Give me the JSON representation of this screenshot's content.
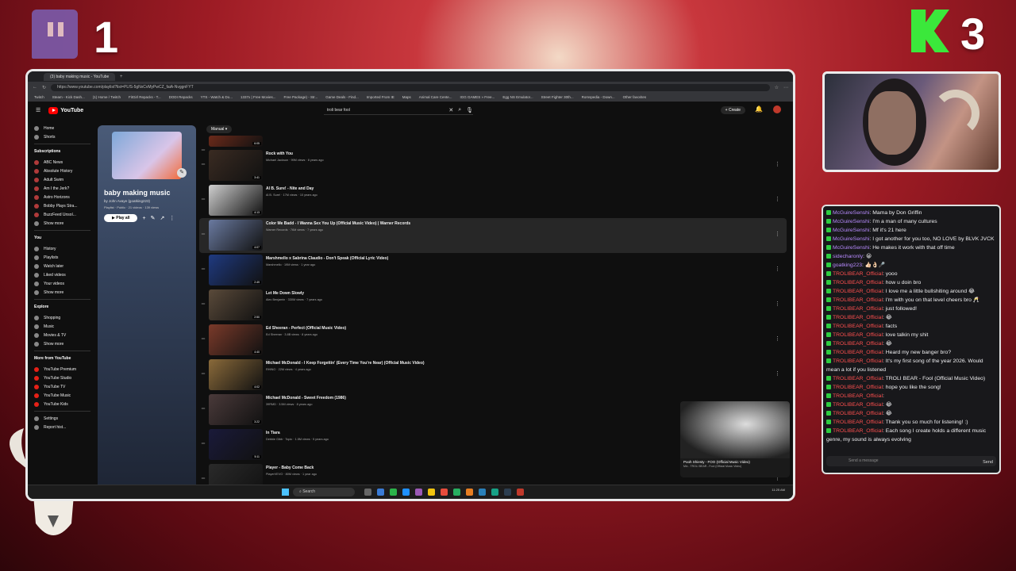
{
  "overlay": {
    "twitch_count": "1",
    "kick_count": "3"
  },
  "browser": {
    "tabs": [
      "(3) baby making music - YouTube"
    ],
    "url": "https://www.youtube.com/playlist?list=PLfS-5gNxCvMyPwCZ_faiA-NvggnFYT",
    "bookmarks": [
      "Twitch",
      "Steam - Kick Dash...",
      "(1) Home / Twitch",
      "FitGirl Repacks - T...",
      "DODI Repacks",
      "YTS - Watch & Do...",
      "1337x | Free Movies...",
      "Free Package) - Str...",
      "Game Deals - Find...",
      "Imported From IE",
      "Maps",
      "Animal Care Cente...",
      "IGG GAMES » Free...",
      "Egg NS Emulator...",
      "Street Fighter 30th...",
      "Romspedia - Down...",
      "Other favorites"
    ]
  },
  "youtube": {
    "logo_text": "YouTube",
    "search_value": "troli bear fool",
    "create_label": "Create",
    "sidebar": {
      "top": [
        "Home",
        "Shorts"
      ],
      "subscriptions_header": "Subscriptions",
      "subscriptions": [
        "ABC News",
        "Absolute History",
        "Adult Swim",
        "Am I the Jerk?",
        "Astro Horizons",
        "Bobby Plays Stra...",
        "BuzzFeed Unsol..."
      ],
      "subs_show_more": "Show more",
      "you_header": "You",
      "you_items": [
        "History",
        "Playlists",
        "Watch later",
        "Liked videos",
        "Your videos"
      ],
      "you_show_more": "Show more",
      "explore_header": "Explore",
      "explore_items": [
        "Shopping",
        "Music",
        "Movies & TV"
      ],
      "explore_show_more": "Show more",
      "more_header": "More from YouTube",
      "more_items": [
        "YouTube Premium",
        "YouTube Studio",
        "YouTube TV",
        "YouTube Music",
        "YouTube Kids"
      ],
      "bottom_items": [
        "Settings",
        "Report hist..."
      ]
    },
    "playlist": {
      "title": "baby making music",
      "owner": "by John Avaye (goatking223)",
      "meta": "Playlist · Public · 21 videos · 139 views",
      "play_all": "Play all",
      "sort_label": "Manual"
    },
    "videos": [
      {
        "title": "",
        "meta": "",
        "duration": "6:05"
      },
      {
        "title": "Rock with You",
        "meta": "Michael Jackson · 99M views · 8 years ago",
        "duration": "3:41"
      },
      {
        "title": "Al B. Sure! - Nite and Day",
        "meta": "Al B. Sure! · 17M views · 10 years ago",
        "duration": "4:13"
      },
      {
        "title": "Color Me Badd - I Wanna Sex You Up (Official Music Video) | Warner Records",
        "meta": "Warner Records · 76M views · 7 years ago",
        "duration": "4:07"
      },
      {
        "title": "Marshmello x Sabrina Claudio - Don't Speak (Official Lyric Video)",
        "meta": "Marshmello · 19M views · 1 year ago",
        "duration": "2:49"
      },
      {
        "title": "Let Me Down Slowly",
        "meta": "Alec Benjamin · 330M views · 7 years ago",
        "duration": "2:50"
      },
      {
        "title": "Ed Sheeran - Perfect (Official Music Video)",
        "meta": "Ed Sheeran · 3.8B views · 8 years ago",
        "duration": "4:40"
      },
      {
        "title": "Michael McDonald - I Keep Forgettin' (Every Time You're Near) (Official Music Video)",
        "meta": "RHINO · 22M views · 4 years ago",
        "duration": "4:02"
      },
      {
        "title": "Michael McDonald - Sweet Freedom (1986)",
        "meta": "39RMD · 3.5M views · 8 years ago",
        "duration": "3:22"
      },
      {
        "title": "In Tiara",
        "meta": "Debbie Gibb · Topic · 1.5M views · 5 years ago",
        "duration": "5:11"
      },
      {
        "title": "Player - Baby Come Back",
        "meta": "PlayerVEVO · 80M views · 1 year ago",
        "duration": ""
      }
    ],
    "miniplayer": {
      "title": "Pooh Shiesty - FOO (Official Music Video)",
      "sub": "Mix - TROLI BEAR - Fool (Official Music Video)"
    }
  },
  "taskbar": {
    "search_label": "Search",
    "clock": "11:25 AM"
  },
  "chat": {
    "messages": [
      {
        "user": "McGuireSenshi",
        "color": "#b88bff",
        "text": "Mama by Don Griffin"
      },
      {
        "user": "McGuireSenshi",
        "color": "#b88bff",
        "text": "I'm a man of many cultures"
      },
      {
        "user": "McGuireSenshi",
        "color": "#b88bff",
        "text": "Mf it's 21 here"
      },
      {
        "user": "McGuireSenshi",
        "color": "#b88bff",
        "text": "I got another for you too, NO LOVE by BLVK JVCK"
      },
      {
        "user": "McGuireSenshi",
        "color": "#b88bff",
        "text": "He makes it work with that off time"
      },
      {
        "user": "sidecharonly",
        "color": "#b88bff",
        "text": "😀"
      },
      {
        "user": "goatking223",
        "color": "#b88bff",
        "text": "👍🏻👌🏻🎤"
      },
      {
        "user": "TROLIBEAR_Official",
        "color": "#ff4f4f",
        "text": "yooo"
      },
      {
        "user": "TROLIBEAR_Official",
        "color": "#ff4f4f",
        "text": "how u doin bro"
      },
      {
        "user": "TROLIBEAR_Official",
        "color": "#ff4f4f",
        "text": "I love me a little bullshiting around 😂"
      },
      {
        "user": "TROLIBEAR_Official",
        "color": "#ff4f4f",
        "text": "I'm with you on that level cheers bro 🥂"
      },
      {
        "user": "TROLIBEAR_Official",
        "color": "#ff4f4f",
        "text": "just followed!"
      },
      {
        "user": "TROLIBEAR_Official",
        "color": "#ff4f4f",
        "text": "😂"
      },
      {
        "user": "TROLIBEAR_Official",
        "color": "#ff4f4f",
        "text": "facts"
      },
      {
        "user": "TROLIBEAR_Official",
        "color": "#ff4f4f",
        "text": "love talkin my shit"
      },
      {
        "user": "TROLIBEAR_Official",
        "color": "#ff4f4f",
        "text": "😂"
      },
      {
        "user": "TROLIBEAR_Official",
        "color": "#ff4f4f",
        "text": "Heard my new banger bro?"
      },
      {
        "user": "TROLIBEAR_Official",
        "color": "#ff4f4f",
        "text": "It's my first song of the year 2026. Would mean a lot if you listened"
      },
      {
        "user": "TROLIBEAR_Official",
        "color": "#ff4f4f",
        "text": "TROLI BEAR - Fool (Official Music Video)"
      },
      {
        "user": "TROLIBEAR_Official",
        "color": "#ff4f4f",
        "text": "hope you like the song!"
      },
      {
        "user": "TROLIBEAR_Official",
        "color": "#ff4f4f",
        "text": ""
      },
      {
        "user": "TROLIBEAR_Official",
        "color": "#ff4f4f",
        "text": "😂"
      },
      {
        "user": "TROLIBEAR_Official",
        "color": "#ff4f4f",
        "text": "😂"
      },
      {
        "user": "TROLIBEAR_Official",
        "color": "#ff4f4f",
        "text": "Thank you so much for listening! :)"
      },
      {
        "user": "TROLIBEAR_Official",
        "color": "#ff4f4f",
        "text": "Each song I create holds a different music genre, my sound is always evolving"
      }
    ],
    "input_placeholder": "Send a message",
    "send_label": "Send"
  },
  "colors": {
    "yt_red": "#ff0000",
    "kick_green": "#3be83b",
    "twitch_purple": "#7b5fb3"
  }
}
